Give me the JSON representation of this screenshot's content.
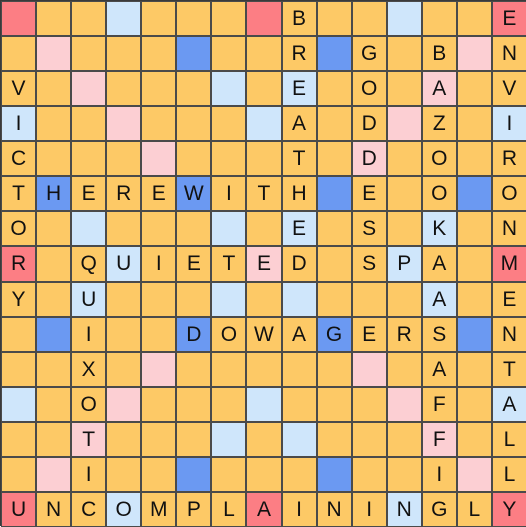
{
  "board": {
    "size": 15,
    "colors": {
      "N": "#fdc966",
      "R": "#fc7e84",
      "P": "#fccfd3",
      "B": "#6b99f2",
      "L": "#cfe6fb"
    },
    "premium_layout": [
      "RNNLNNNRNNNLNNR",
      "NPNNNBNNNBNNNPN",
      "NNPNNNLNLNNNPNN",
      "LNNPNNNLNNNPNNL",
      "NNNNPNNNNNPNNNN",
      "NBNNNBNNNBNNNBN",
      "NNLNNNLNLNNNLNN",
      "RNNLNNNPNNNLNNR",
      "NNLNNNLNLNNNLNN",
      "NBNNNBNNNBNNNBN",
      "NNNNPNNNNNPNNNN",
      "LNNPNNNLNNNPNNL",
      "NNPNNNLNLNNNPNN",
      "NPNNNBNNNBNNNPN",
      "RNNLNNNRNNNLNNR"
    ],
    "letters": [
      "........B.....E",
      "........R.G.B.N",
      "V.......E.O.A.V",
      "I.......A.D.Z.I",
      "C.......T.D.O.R",
      "THEREWITH.E.O.O",
      "O.......E.S.K.N",
      "R.QUIETED.SPA.M",
      "Y.U.........A.E",
      "..I..DOWAGERS.N",
      "..X.........A.T",
      "..O.........F.A",
      "..T.........F.L",
      "..I.........I.L",
      "UNCOMPLAININGLY"
    ],
    "words": [
      "BREATHED",
      "GODDESS",
      "BAZOOKA",
      "ENVIRONMENTALLY",
      "VICTORY",
      "THEREWITH",
      "QUIETED",
      "SPA",
      "QUIXOTIC",
      "DOWAGERS",
      "SPARAFFIN",
      "UNCOMPLAININGLY"
    ]
  }
}
